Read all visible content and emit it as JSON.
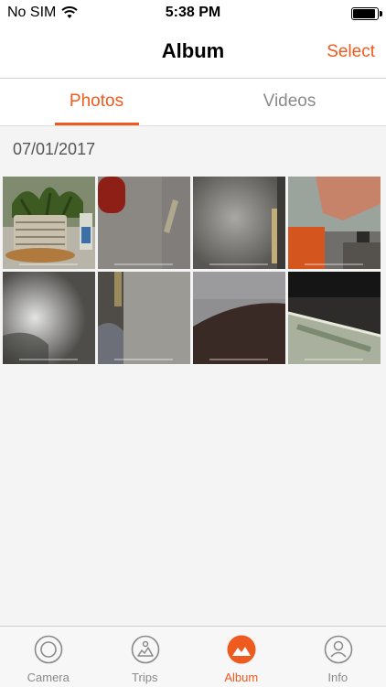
{
  "status_bar": {
    "carrier": "No SIM",
    "time": "5:38 PM",
    "battery_level": 1.0
  },
  "nav": {
    "title": "Album",
    "select_label": "Select"
  },
  "tabs": [
    {
      "label": "Photos",
      "active": true
    },
    {
      "label": "Videos",
      "active": false
    }
  ],
  "date_group": "07/01/2017",
  "photos_count": 8,
  "tab_bar": [
    {
      "label": "Camera",
      "icon": "camera-icon",
      "active": false
    },
    {
      "label": "Trips",
      "icon": "map-icon",
      "active": false
    },
    {
      "label": "Album",
      "icon": "album-icon",
      "active": true
    },
    {
      "label": "Info",
      "icon": "user-icon",
      "active": false
    }
  ],
  "colors": {
    "accent": "#ef5a1e",
    "inactive": "#8a8a8a",
    "background": "#f4f4f4"
  }
}
